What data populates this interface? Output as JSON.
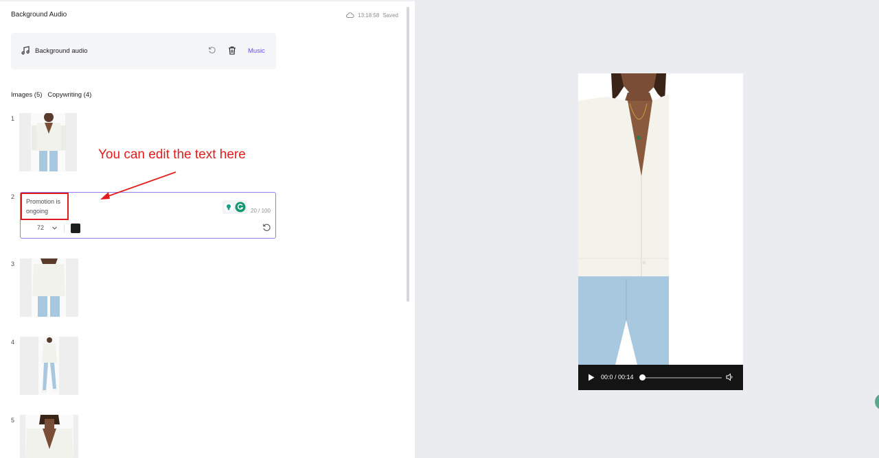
{
  "header": {
    "title": "Background Audio",
    "save_time": "13:18:58",
    "save_status": "Saved"
  },
  "audio": {
    "label": "Background audio",
    "music_label": "Music"
  },
  "tabs": [
    {
      "label": "Images (5)"
    },
    {
      "label": "Copywriting (4)"
    }
  ],
  "items": [
    {
      "index": "1"
    },
    {
      "index": "2",
      "text": "Promotion is ongoing",
      "char_count": "20 / 100",
      "font_size": "72",
      "color": "#1d1d1f"
    },
    {
      "index": "3"
    },
    {
      "index": "4"
    },
    {
      "index": "5"
    }
  ],
  "annotation": {
    "text": "You can edit the text here",
    "color": "#e21b1b"
  },
  "player": {
    "time": "00:0 / 00:14",
    "progress": 0
  },
  "colors": {
    "accent": "#6a4cf5",
    "panel_bg": "#ebecef",
    "card_bg": "#f4f5f7"
  },
  "icons": [
    "cloud-icon",
    "music-note-icon",
    "reset-icon",
    "trash-icon",
    "play-icon",
    "volume-icon",
    "chevron-down-icon",
    "undo-icon"
  ]
}
